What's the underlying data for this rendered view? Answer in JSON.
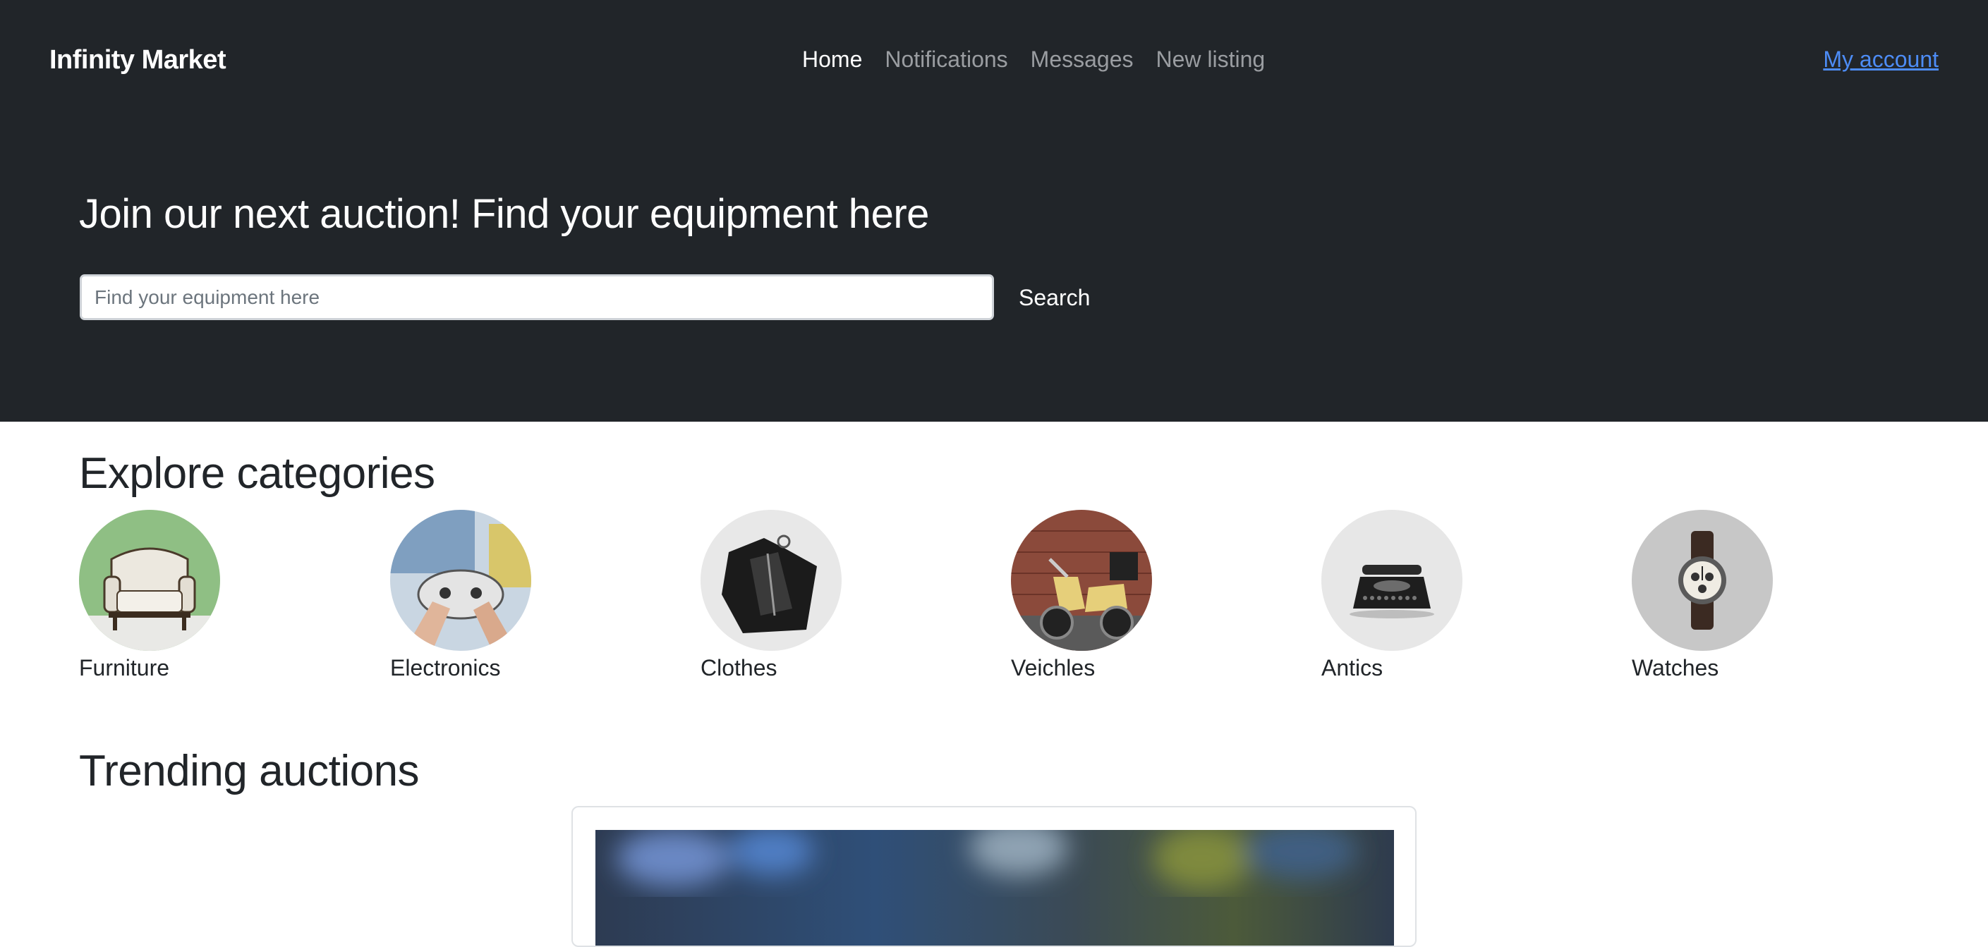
{
  "header": {
    "brand": "Infinity Market",
    "nav": [
      "Home",
      "Notifications",
      "Messages",
      "New listing"
    ],
    "active_nav": "Home",
    "account_link": "My account"
  },
  "hero": {
    "title": "Join our next auction! Find your equipment here",
    "search_placeholder": "Find your equipment here",
    "search_value": "",
    "search_button": "Search"
  },
  "categories": {
    "title": "Explore categories",
    "items": [
      {
        "label": "Furniture",
        "icon": "armchair-photo"
      },
      {
        "label": "Electronics",
        "icon": "game-controller-photo"
      },
      {
        "label": "Clothes",
        "icon": "leather-jacket-photo"
      },
      {
        "label": "Veichles",
        "icon": "scooter-photo"
      },
      {
        "label": "Antics",
        "icon": "typewriter-photo"
      },
      {
        "label": "Watches",
        "icon": "wristwatch-photo"
      }
    ]
  },
  "trending": {
    "title": "Trending auctions"
  },
  "colors": {
    "hero_bg": "#212529",
    "link": "#4d8cf5",
    "nav_inactive": "#9a9da1"
  }
}
